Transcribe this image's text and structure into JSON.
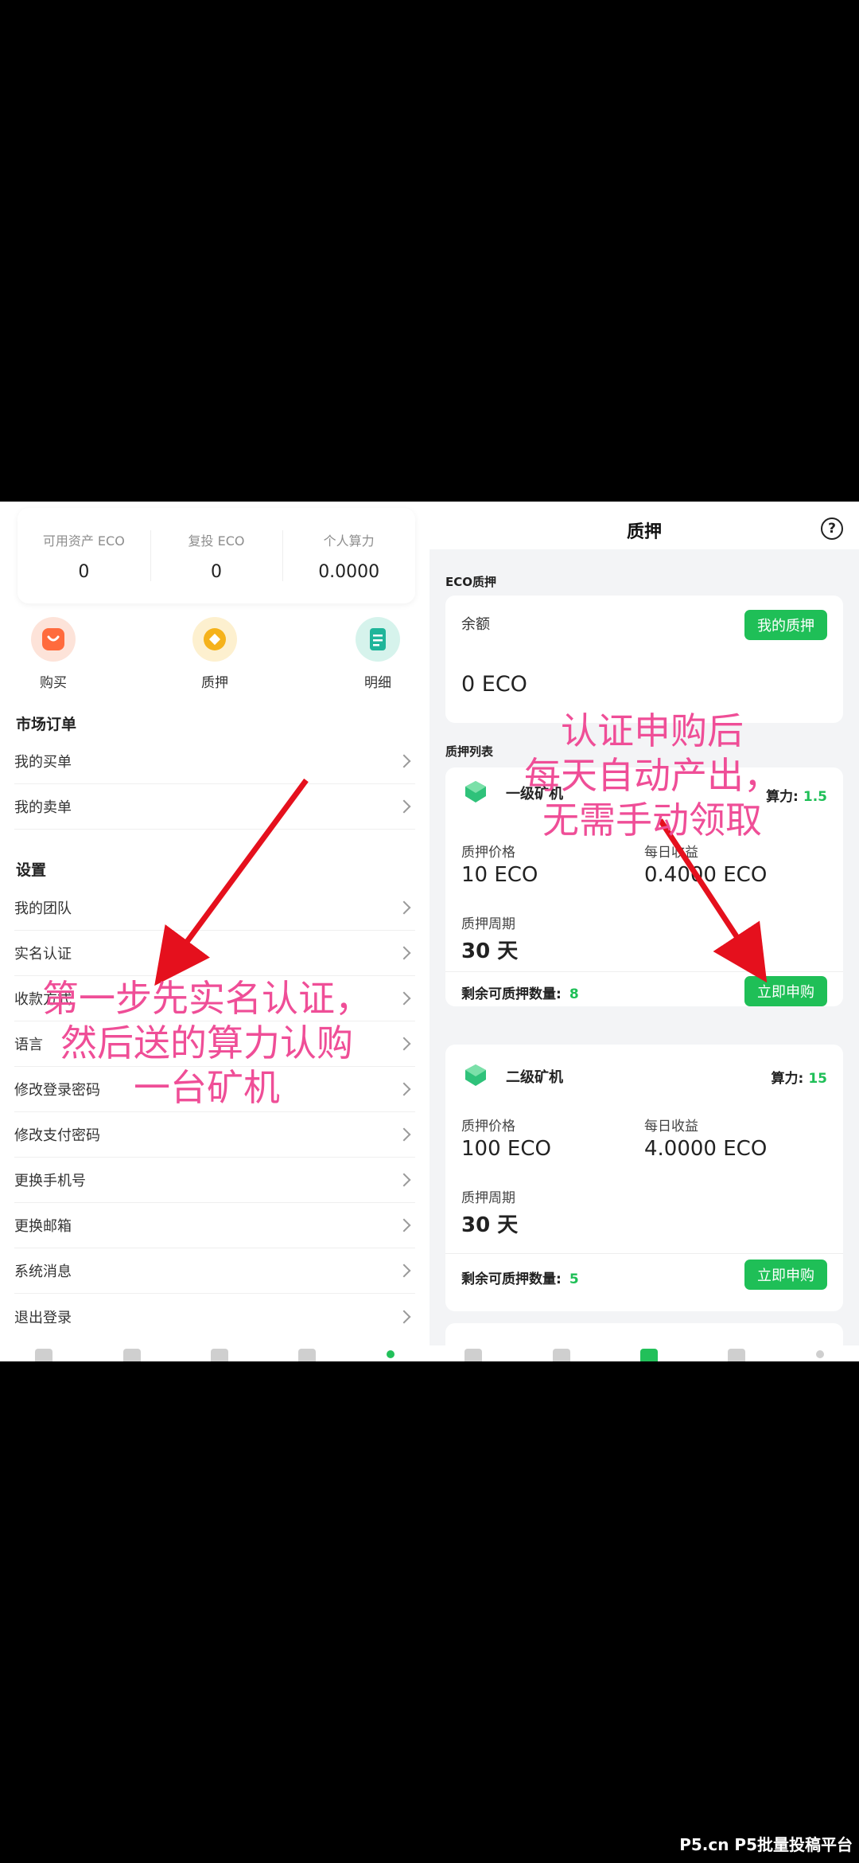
{
  "left": {
    "stats": [
      {
        "label": "可用资产 ECO",
        "value": "0"
      },
      {
        "label": "复投 ECO",
        "value": "0"
      },
      {
        "label": "个人算力",
        "value": "0.0000"
      }
    ],
    "shortcuts": [
      {
        "label": "购买",
        "icon": "shopping-bag-icon"
      },
      {
        "label": "质押",
        "icon": "coin-icon"
      },
      {
        "label": "明细",
        "icon": "document-icon"
      }
    ],
    "market_title": "市场订单",
    "market_items": [
      {
        "label": "我的买单"
      },
      {
        "label": "我的卖单"
      }
    ],
    "settings_title": "设置",
    "settings_items": [
      {
        "label": "我的团队"
      },
      {
        "label": "实名认证"
      },
      {
        "label": "收款方式"
      },
      {
        "label": "语言"
      },
      {
        "label": "修改登录密码"
      },
      {
        "label": "修改支付密码"
      },
      {
        "label": "更换手机号"
      },
      {
        "label": "更换邮箱"
      },
      {
        "label": "系统消息"
      },
      {
        "label": "退出登录"
      }
    ]
  },
  "right": {
    "title": "质押",
    "eco_section": "ECO质押",
    "balance_label": "余额",
    "balance_value": "0 ECO",
    "my_pledge_button": "我的质押",
    "list_section": "质押列表",
    "miners": [
      {
        "name": "一级矿机",
        "power_label": "算力:",
        "power_value": "1.5",
        "price_label": "质押价格",
        "price_value": "10 ECO",
        "income_label": "每日收益",
        "income_value": "0.4000 ECO",
        "period_label": "质押周期",
        "period_value": "30 天",
        "remain_label": "剩余可质押数量:",
        "remain_value": "8",
        "button": "立即申购"
      },
      {
        "name": "二级矿机",
        "power_label": "算力:",
        "power_value": "15",
        "price_label": "质押价格",
        "price_value": "100 ECO",
        "income_label": "每日收益",
        "income_value": "4.0000 ECO",
        "period_label": "质押周期",
        "period_value": "30 天",
        "remain_label": "剩余可质押数量:",
        "remain_value": "5",
        "button": "立即申购"
      }
    ]
  },
  "annotations": {
    "left_text": [
      "第一步先实名认证，",
      "然后送的算力认购",
      "一台矿机"
    ],
    "right_text": [
      "认证申购后",
      "每天自动产出，",
      "无需手动领取"
    ],
    "color": "#ef4e97",
    "arrow_color": "#e5101d"
  },
  "watermark": "P5.cn P5批量投稿平台",
  "colors": {
    "accent": "#1fbf57",
    "annotation": "#ef4e97"
  }
}
